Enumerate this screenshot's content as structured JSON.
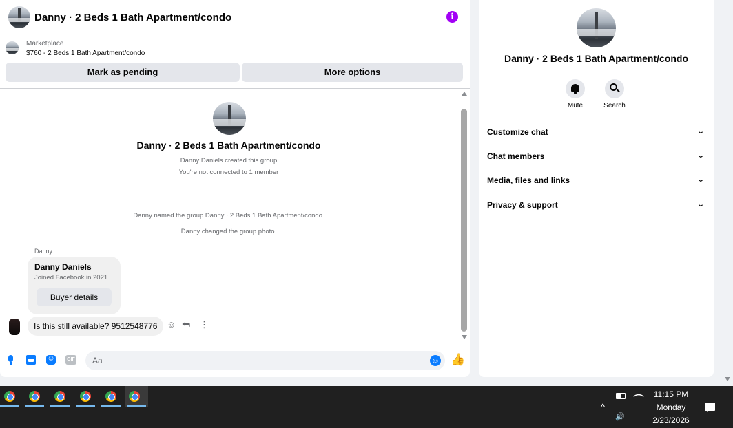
{
  "chat": {
    "title": "Danny · 2 Beds 1 Bath Apartment/condo",
    "info_icon": "i",
    "marketplace": {
      "label": "Marketplace",
      "item": "$760 - 2 Beds 1 Bath Apartment/condo",
      "mark_pending_label": "Mark as pending",
      "more_options_label": "More options"
    },
    "group_name": "Danny · 2 Beds 1 Bath Apartment/condo",
    "created_text": "Danny Daniels created this group",
    "connection_text": "You're not connected to 1 member",
    "named_text": "Danny named the group Danny · 2 Beds 1 Bath Apartment/condo.",
    "photo_text": "Danny changed the group photo.",
    "sender_name": "Danny",
    "card": {
      "name": "Danny Daniels",
      "joined": "Joined Facebook in 2021",
      "buyer_details_label": "Buyer details"
    },
    "message_text": "Is this still available? 9512548776",
    "composer": {
      "gif_label": "GIF",
      "placeholder": "Aa"
    }
  },
  "info_panel": {
    "title": "Danny · 2 Beds 1 Bath Apartment/condo",
    "mute_label": "Mute",
    "search_label": "Search",
    "sections": [
      "Customize chat",
      "Chat members",
      "Media, files and links",
      "Privacy & support"
    ]
  },
  "taskbar": {
    "time": "11:15 PM",
    "day": "Monday",
    "date": "2/23/2026"
  },
  "icons": {
    "accent": "#0a7cff",
    "info_color": "#a200f5",
    "names": [
      "info-icon",
      "microphone-icon",
      "photo-icon",
      "sticker-icon",
      "gif-icon",
      "emoji-icon",
      "like-icon",
      "bell-icon",
      "search-icon",
      "chevron-down-icon",
      "chrome-icon"
    ]
  }
}
